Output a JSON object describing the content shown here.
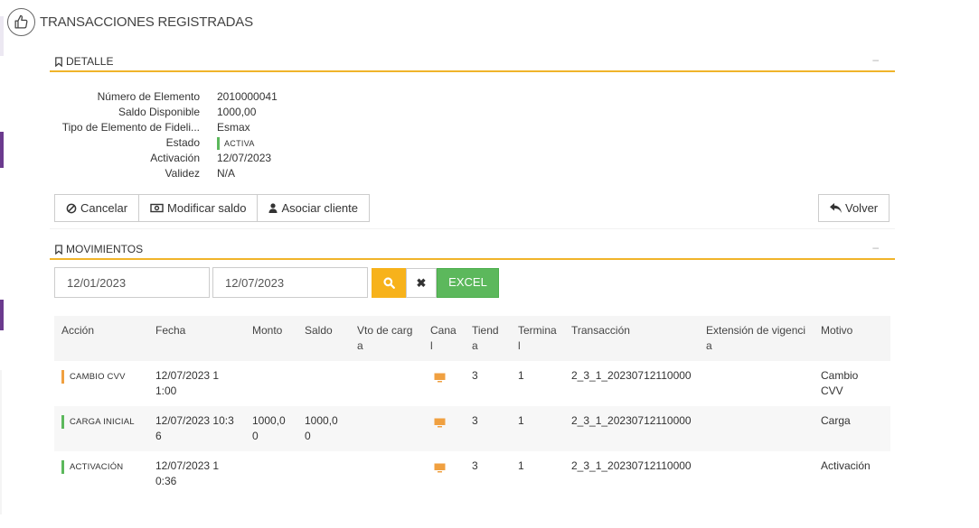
{
  "page": {
    "title": "TRANSACCIONES REGISTRADAS",
    "icon": "thumbs-up-icon"
  },
  "detail_section": {
    "title": "DETALLE",
    "collapse": "–"
  },
  "detail": {
    "numero_label": "Número de Elemento",
    "numero_value": "2010000041",
    "saldo_label": "Saldo Disponible",
    "saldo_value": "1000,00",
    "tipo_label": "Tipo de Elemento de Fideli...",
    "tipo_value": "Esmax",
    "estado_label": "Estado",
    "estado_value": "ACTIVA",
    "activacion_label": "Activación",
    "activacion_value": "12/07/2023",
    "validez_label": "Validez",
    "validez_value": "N/A"
  },
  "actions": {
    "cancelar": "Cancelar",
    "modificar": "Modificar saldo",
    "asociar": "Asociar cliente",
    "volver": "Volver"
  },
  "movements_section": {
    "title": "MOVIMIENTOS",
    "collapse": "–"
  },
  "filters": {
    "date_from": "12/01/2023",
    "date_to": "12/07/2023",
    "excel": "EXCEL"
  },
  "table": {
    "headers": {
      "accion": "Acción",
      "fecha": "Fecha",
      "monto": "Monto",
      "saldo": "Saldo",
      "vto": "Vto de carga",
      "canal": "Canal",
      "tienda": "Tienda",
      "terminal": "Terminal",
      "transaccion": "Transacción",
      "extension": "Extensión de vigencia",
      "motivo": "Motivo"
    },
    "rows": [
      {
        "accion": "CAMBIO CVV",
        "accion_color": "#f0a040",
        "fecha": "12/07/2023 11:00",
        "monto": "",
        "saldo": "",
        "vto": "",
        "canal": "monitor-icon",
        "tienda": "3",
        "terminal": "1",
        "transaccion": "2_3_1_20230712110000",
        "extension": "",
        "motivo": "Cambio CVV"
      },
      {
        "accion": "CARGA INICIAL",
        "accion_color": "#5cb85c",
        "fecha": "12/07/2023 10:36",
        "monto": "1000,00",
        "saldo": "1000,00",
        "vto": "",
        "canal": "monitor-icon",
        "tienda": "3",
        "terminal": "1",
        "transaccion": "2_3_1_20230712110000",
        "extension": "",
        "motivo": "Carga"
      },
      {
        "accion": "ACTIVACIÓN",
        "accion_color": "#5cb85c",
        "fecha": "12/07/2023 10:36",
        "monto": "",
        "saldo": "",
        "vto": "",
        "canal": "monitor-icon",
        "tienda": "3",
        "terminal": "1",
        "transaccion": "2_3_1_20230712110000",
        "extension": "",
        "motivo": "Activación"
      }
    ]
  },
  "colors": {
    "accent": "#f0b42a",
    "search": "#f7b21b",
    "excel": "#5cb85c",
    "active": "#5cb85c",
    "warning": "#f0a040",
    "sidebar": "#6b3a8e"
  }
}
